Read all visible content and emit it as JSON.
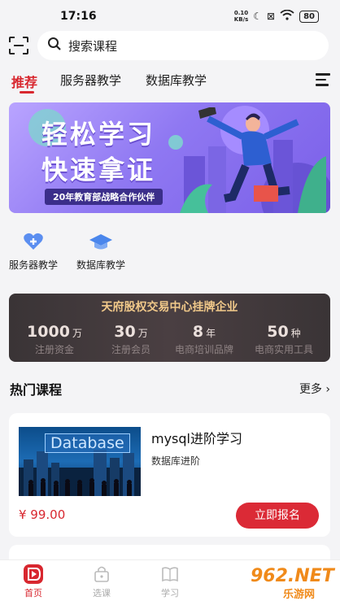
{
  "status_bar": {
    "time": "17:16",
    "net_speed_value": "0.10",
    "net_speed_unit": "KB/s",
    "battery": "80"
  },
  "search": {
    "placeholder": "搜索课程"
  },
  "tabs": [
    {
      "label": "推荐",
      "active": true
    },
    {
      "label": "服务器教学",
      "active": false
    },
    {
      "label": "数据库教学",
      "active": false
    }
  ],
  "banner": {
    "line1": "轻松学习",
    "line2": "快速拿证",
    "tag": "20年教育部战略合作伙伴"
  },
  "categories": [
    {
      "label": "服务器教学",
      "icon": "heart-medkit-icon"
    },
    {
      "label": "数据库教学",
      "icon": "graduation-cap-icon"
    }
  ],
  "stats": {
    "title": "天府股权交易中心挂牌企业",
    "items": [
      {
        "value": "1000",
        "unit": "万",
        "label": "注册资金"
      },
      {
        "value": "30",
        "unit": "万",
        "label": "注册会员"
      },
      {
        "value": "8",
        "unit": "年",
        "label": "电商培训品牌"
      },
      {
        "value": "50",
        "unit": "种",
        "label": "电商实用工具"
      }
    ]
  },
  "hot_courses": {
    "title": "热门课程",
    "more": "更多",
    "courses": [
      {
        "image_text": "Database",
        "title": "mysql进阶学习",
        "subtitle": "数据库进阶",
        "price": "¥ 99.00",
        "button": "立即报名"
      }
    ]
  },
  "bottom_nav": [
    {
      "label": "首页",
      "active": true
    },
    {
      "label": "选课",
      "active": false
    },
    {
      "label": "学习",
      "active": false
    }
  ],
  "watermark": {
    "big": "962.NET",
    "small": "乐游网"
  },
  "colors": {
    "accent": "#d8272f",
    "banner": "#8f78f2",
    "stats_bg": "#3a3436",
    "stats_title": "#f1c98a"
  }
}
